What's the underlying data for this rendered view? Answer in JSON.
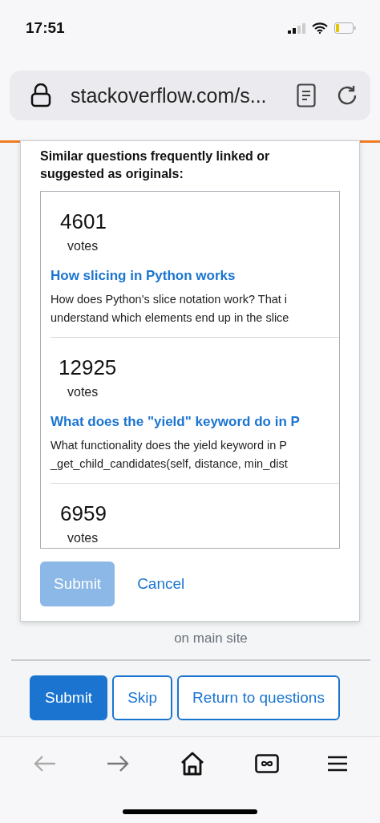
{
  "status_bar": {
    "time": "17:51"
  },
  "address_bar": {
    "url": "stackoverflow.com/s..."
  },
  "dialog": {
    "heading": "Similar questions frequently linked or suggested as originals:",
    "questions": [
      {
        "votes": "4601",
        "votes_label": "votes",
        "title": "How slicing in Python works",
        "excerpt": [
          "How does Python's slice notation work? That i",
          "understand which elements end up in the slice"
        ]
      },
      {
        "votes": "12925",
        "votes_label": "votes",
        "title": "What does the \"yield\" keyword do in P",
        "excerpt": [
          "What functionality does the yield keyword in P",
          "_get_child_candidates(self, distance, min_dist"
        ]
      },
      {
        "votes": "6959",
        "votes_label": "votes"
      }
    ],
    "submit": {
      "label": "Submit",
      "disabled": true
    },
    "cancel": "Cancel"
  },
  "page": {
    "note": "on main site",
    "buttons": [
      {
        "label": "Submit",
        "kind": "primary"
      },
      {
        "label": "Skip",
        "kind": "outline"
      },
      {
        "label": "Return to questions",
        "kind": "outline"
      }
    ]
  },
  "toolbar": {
    "back_disabled": true
  }
}
